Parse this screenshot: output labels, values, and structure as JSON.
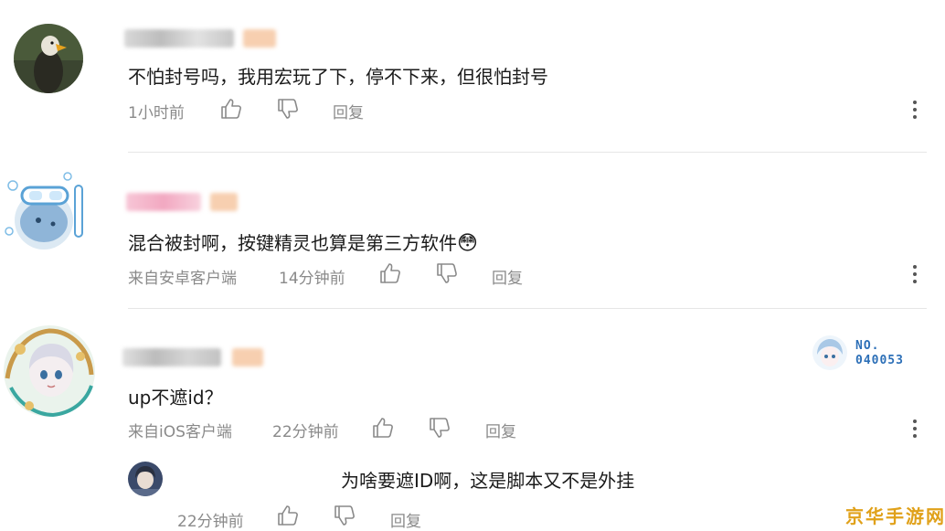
{
  "comments": [
    {
      "text": "不怕封号吗，我用宏玩了下，停不下来，但很怕封号",
      "time": "1小时前",
      "reply_label": "回复"
    },
    {
      "text": "混合被封啊，按键精灵也算是第三方软件",
      "source": "来自安卓客户端",
      "time": "14分钟前",
      "reply_label": "回复",
      "emoji": "😳"
    },
    {
      "text": "up不遮id？",
      "source": "来自iOS客户端",
      "time": "22分钟前",
      "reply_label": "回复",
      "badge_line1": "NO.",
      "badge_line2": "040053"
    }
  ],
  "reply": {
    "text": "为啥要遮ID啊，这是脚本又不是外挂",
    "time": "22分钟前",
    "reply_label": "回复"
  },
  "watermark": "京华手游网",
  "colors": {
    "meta_text": "#8a8a8a",
    "badge_blue": "#2c6fb7",
    "watermark": "#e0a11a"
  }
}
